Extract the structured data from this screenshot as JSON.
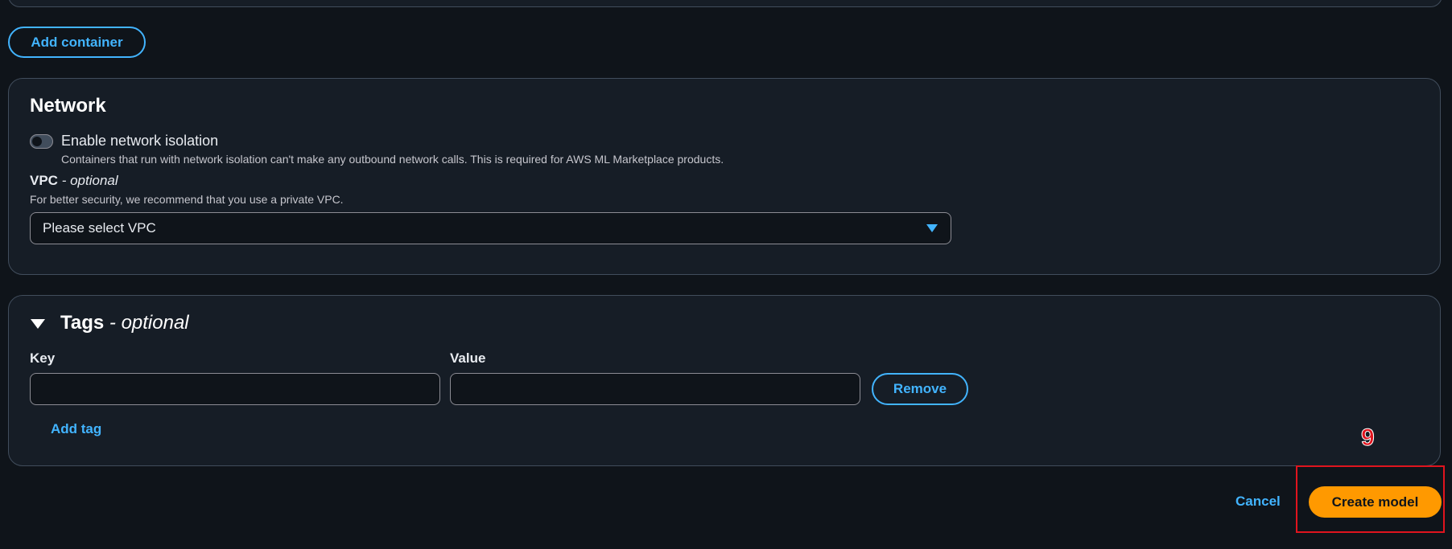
{
  "toolbar": {
    "add_container_label": "Add container"
  },
  "network": {
    "title": "Network",
    "isolation_toggle_label": "Enable network isolation",
    "isolation_toggle_on": false,
    "isolation_description": "Containers that run with network isolation can't make any outbound network calls. This is required for AWS ML Marketplace products.",
    "vpc_label": "VPC",
    "vpc_optional": " - optional",
    "vpc_description": "For better security, we recommend that you use a private VPC.",
    "vpc_select_value": "Please select VPC",
    "vpc_select_icon": "caret-down-icon"
  },
  "tags": {
    "title": "Tags",
    "title_optional": " - optional",
    "expanded": true,
    "key_label": "Key",
    "value_label": "Value",
    "key_value": "",
    "value_value": "",
    "remove_label": "Remove",
    "add_tag_label": "Add tag"
  },
  "footer": {
    "cancel_label": "Cancel",
    "create_label": "Create model"
  },
  "annotation": {
    "number": "9",
    "color": "#e0141e"
  },
  "colors": {
    "background": "#0f141a",
    "card": "#161d26",
    "accent_link": "#42b4ff",
    "primary_button": "#ff9900",
    "border": "#414d5c"
  }
}
